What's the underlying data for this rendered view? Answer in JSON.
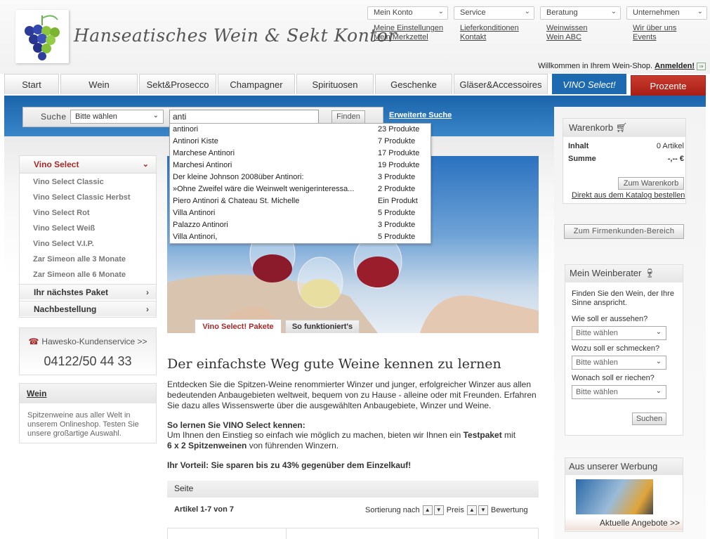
{
  "header": {
    "logo_text": "Hanseatisches Wein & Sekt Kontor",
    "menus": [
      {
        "label": "Mein Konto",
        "links": [
          "Meine Einstellungen",
          "Mein Merkzettel"
        ]
      },
      {
        "label": "Service",
        "links": [
          "Lieferkonditionen",
          "Kontakt"
        ]
      },
      {
        "label": "Beratung",
        "links": [
          "Weinwissen",
          "Wein ABC"
        ]
      },
      {
        "label": "Unternehmen",
        "links": [
          "Wir über uns",
          "Events"
        ]
      }
    ],
    "welcome": "Willkommen in Ihrem Wein-Shop.",
    "login": "Anmelden!"
  },
  "nav": {
    "tabs": [
      "Start",
      "Wein",
      "Sekt&Prosecco",
      "Champagner",
      "Spirituosen",
      "Geschenke",
      "Gläser&Accessoires",
      "VINO Select!",
      "Prozente"
    ]
  },
  "search": {
    "label": "Suche",
    "select_value": "Bitte wählen",
    "input_value": "anti",
    "button": "Finden",
    "advanced": "Erweiterte Suche"
  },
  "autocomplete": [
    {
      "term": "antinori",
      "count": "23 Produkte"
    },
    {
      "term": "Antinori Kiste",
      "count": "7 Produkte"
    },
    {
      "term": "Marchese Antinori",
      "count": "17 Produkte"
    },
    {
      "term": "Marchesi Antinori",
      "count": "19 Produkte"
    },
    {
      "term": "Der kleine Johnson 2008über Antinori:",
      "count": "3 Produkte"
    },
    {
      "term": "»Ohne Zweifel wäre die Weinwelt wenigerinteressa...",
      "count": "2 Produkte"
    },
    {
      "term": "Piero Antinori & Chateau St. Michelle",
      "count": "Ein Produkt"
    },
    {
      "term": "Villa Antinori",
      "count": "5 Produkte"
    },
    {
      "term": "Palazzo Antinori",
      "count": "3 Produkte"
    },
    {
      "term": "Villa Antinori,",
      "count": "5 Produkte"
    }
  ],
  "sidebar": {
    "head": "Vino Select",
    "subitems": [
      "Vino Select Classic",
      "Vino Select Classic Herbst",
      "Vino Select Rot",
      "Vino Select Weiß",
      "Vino Select V.I.P.",
      "Zar Simeon alle 3 Monate",
      "Zar Simeon alle 6 Monate"
    ],
    "rows": [
      "Ihr nächstes Paket",
      "Nachbestellung"
    ],
    "service_title": "Hawesko-Kundenservice >>",
    "phone": "04122/50 44 33",
    "wein_head": "Wein",
    "wein_text": "Spitzenweine aus aller Welt in unserem Onlineshop. Testen Sie unsere großartige Auswahl."
  },
  "banner": {
    "tab1": "Vino Select! Pakete",
    "tab2": "So funktioniert's"
  },
  "content": {
    "headline": "Der einfachste Weg gute Weine kennen zu lernen",
    "p1": "Entdecken Sie die Spitzen-Weine renommierter Winzer und junger, erfolgreicher Winzer aus allen bedeutenden Anbaugebieten weltweit, bequem von zu Hause - alleine oder mit Freunden. Erfahren Sie dazu alles Wissenswerte über die ausgewählten Anbaugebiete, Winzer und Weine.",
    "p2_head": "So lernen Sie VINO Select kennen:",
    "p2_a": "Um Ihnen den Einstieg so einfach wie möglich zu machen, bieten wir Ihnen ein ",
    "p2_b": "Testpaket",
    "p2_c": " mit",
    "p2_d": "6 x 2 Spitzenweinen",
    "p2_e": " von führenden Winzern.",
    "p3": "Ihr Vorteil: Sie sparen bis zu 43% gegenüber dem Einzelkauf!",
    "pager": "Seite",
    "count": "Artikel 1-7 von 7",
    "sort_label": "Sortierung nach",
    "sort_price": "Preis",
    "sort_rating": "Bewertung"
  },
  "cart": {
    "title": "Warenkorb",
    "content_label": "Inhalt",
    "content_value": "0 Artikel",
    "sum_label": "Summe",
    "sum_value": "-,-- €",
    "button": "Zum Warenkorb",
    "catalog_link": "Direkt aus dem Katalog bestellen"
  },
  "firm_button": "Zum Firmenkunden-Bereich",
  "advisor": {
    "title": "Mein Weinberater",
    "intro": "Finden Sie den Wein, der Ihre Sinne anspricht.",
    "questions": [
      "Wie soll er aussehen?",
      "Wozu soll er schmecken?",
      "Wonach soll er riechen?"
    ],
    "select_value": "Bitte wählen",
    "button": "Suchen"
  },
  "ads": {
    "title": "Aus unserer Werbung",
    "link": "Aktuelle Angebote >>"
  }
}
